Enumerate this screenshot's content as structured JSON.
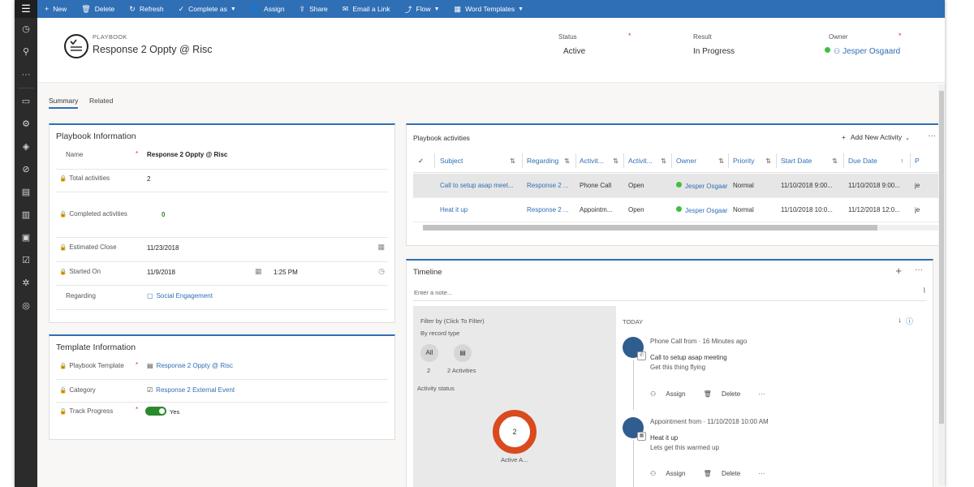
{
  "commands": [
    {
      "icon": "+",
      "label": "New"
    },
    {
      "icon": "🗑",
      "label": "Delete"
    },
    {
      "icon": "↻",
      "label": "Refresh"
    },
    {
      "icon": "✓",
      "label": "Complete as",
      "dropdown": true
    },
    {
      "icon": "👤",
      "label": "Assign"
    },
    {
      "icon": "⇪",
      "label": "Share"
    },
    {
      "icon": "✉",
      "label": "Email a Link"
    },
    {
      "icon": "⤴",
      "label": "Flow",
      "dropdown": true
    },
    {
      "icon": "▦",
      "label": "Word Templates",
      "dropdown": true
    }
  ],
  "header": {
    "entity_type": "PLAYBOOK",
    "title": "Response 2 Oppty @ Risc",
    "status_label": "Status",
    "status_value": "Active",
    "result_label": "Result",
    "result_value": "In Progress",
    "owner_label": "Owner",
    "owner_value": "Jesper Osgaard"
  },
  "tabs": [
    "Summary",
    "Related"
  ],
  "playbook_info": {
    "title": "Playbook Information",
    "name_label": "Name",
    "name_value": "Response 2 Oppty @ Risc",
    "total_label": "Total activities",
    "total_value": "2",
    "completed_label": "Completed activities",
    "completed_value": "0",
    "est_close_label": "Estimated Close",
    "est_close_value": "11/23/2018",
    "started_label": "Started On",
    "started_date": "11/9/2018",
    "started_time": "1:25 PM",
    "regarding_label": "Regarding",
    "regarding_value": "Social Engagement"
  },
  "template_info": {
    "title": "Template Information",
    "template_label": "Playbook Template",
    "template_value": "Response 2 Oppty @ Risc",
    "category_label": "Category",
    "category_value": "Response 2 External Event",
    "track_label": "Track Progress",
    "track_value": "Yes"
  },
  "activities": {
    "title": "Playbook activities",
    "add_label": "Add New Activity",
    "columns": [
      "Subject",
      "Regarding",
      "Activit...",
      "Activit...",
      "Owner",
      "Priority",
      "Start Date",
      "Due Date",
      "P"
    ],
    "rows": [
      [
        "Call to setup asap meet...",
        "Response 2 ...",
        "Phone Call",
        "Open",
        "Jesper Osgaard",
        "Normal",
        "11/10/2018 9:00...",
        "11/10/2018 9:00...",
        "je"
      ],
      [
        "Heat it up",
        "Response 2 ...",
        "Appointm...",
        "Open",
        "Jesper Osgaard",
        "Normal",
        "11/10/2018 10:0...",
        "11/12/2018 12:0...",
        "je"
      ]
    ]
  },
  "timeline": {
    "title": "Timeline",
    "note_placeholder": "Enter a note...",
    "filter_by": "Filter by",
    "filter_hint": "(Click To Filter)",
    "by_record_type": "By record type",
    "all_label": "All",
    "all_count": "2",
    "activities_count": "2 Activities",
    "activity_status": "Activity status",
    "donut_value": "2",
    "donut_label": "Active A...",
    "today": "TODAY",
    "items": [
      {
        "header": "Phone Call from  ·  16 Minutes ago",
        "line1": "Call to setup asap meeting",
        "line2": "Get this thing flying",
        "assign": "Assign",
        "delete": "Delete"
      },
      {
        "header": "Appointment from  ·  11/10/2018 10:00 AM",
        "line1": "Heat it up",
        "line2": "Lets get this warmed up",
        "assign": "Assign",
        "delete": "Delete"
      }
    ]
  },
  "colors": {
    "accent": "#2f6fb5",
    "nav": "#2b2b2b",
    "donut": "#d94a1e",
    "success": "#2b8a2b"
  }
}
